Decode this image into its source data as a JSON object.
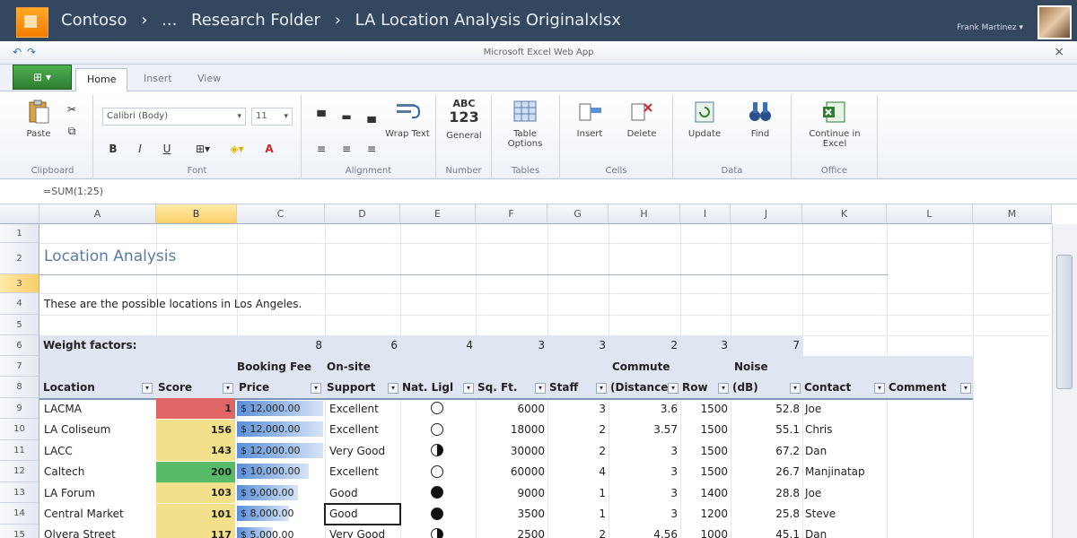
{
  "window": {
    "breadcrumb": [
      "Contoso",
      "›",
      "...",
      "Research Folder",
      "›",
      "LA Location Analysis Originalxlsx"
    ],
    "user": "Frank Martinez ▾",
    "app_title": "Microsoft Excel Web App",
    "close": "×"
  },
  "tabs": {
    "file": "⊞ ▾",
    "items": [
      "Home",
      "Insert",
      "View"
    ]
  },
  "ribbon": {
    "clipboard": {
      "paste": "Paste",
      "label": "Clipboard"
    },
    "font": {
      "name": "Calibri (Body)",
      "size": "11",
      "label": "Font",
      "bold": "B",
      "italic": "I",
      "underline": "U",
      "color_a": "A"
    },
    "alignment": {
      "wrap": "Wrap Text",
      "label": "Alignment"
    },
    "number": {
      "abc": "ABC",
      "num": "123",
      "general": "General",
      "label": "Number"
    },
    "tables": {
      "options": "Table Options",
      "label": "Tables"
    },
    "cells": {
      "insert": "Insert",
      "delete": "Delete",
      "label": "Cells"
    },
    "data": {
      "update": "Update",
      "find": "Find",
      "label": "Data"
    },
    "office": {
      "open": "Continue in Excel",
      "label": "Office"
    }
  },
  "formula": "=SUM(1:25)",
  "columns": [
    "A",
    "B",
    "C",
    "D",
    "E",
    "F",
    "G",
    "H",
    "I",
    "J",
    "K",
    "L",
    "M"
  ],
  "rows": [
    "1",
    "2",
    "3",
    "4",
    "5",
    "6",
    "7",
    "8",
    "9",
    "10",
    "11",
    "12",
    "13",
    "14",
    "15"
  ],
  "sheet": {
    "title": "Location Analysis",
    "subtitle": "These are the possible locations in Los Angeles.",
    "weight_label": "Weight factors:",
    "weights": [
      "8",
      "6",
      "4",
      "3",
      "3",
      "2",
      "3",
      "7"
    ],
    "header_top": {
      "price": "Booking Fee",
      "support": "On-site",
      "commute": "Commute",
      "noise": "Noise"
    },
    "headers": [
      "Location",
      "Score",
      "Price",
      "Support",
      "Nat. Ligl",
      "Sq. Ft.",
      "Staff",
      "(Distance",
      "Row",
      "(dB)",
      "Contact",
      "Comment"
    ],
    "data": [
      {
        "loc": "LACMA",
        "score": "1",
        "price": "$ 12,000.00",
        "support": "Excellent",
        "sqft": "6000",
        "staff": "3",
        "dist": "3.6",
        "row": "1500",
        "db": "52.8",
        "contact": "Joe"
      },
      {
        "loc": "LA Coliseum",
        "score": "156",
        "price": "$ 12,000.00",
        "support": "Excellent",
        "sqft": "18000",
        "staff": "2",
        "dist": "3.57",
        "row": "1500",
        "db": "55.1",
        "contact": "Chris"
      },
      {
        "loc": "LACC",
        "score": "143",
        "price": "$ 12,000.00",
        "support": "Very Good",
        "sqft": "30000",
        "staff": "2",
        "dist": "3",
        "row": "1500",
        "db": "67.2",
        "contact": "Dan"
      },
      {
        "loc": "Caltech",
        "score": "200",
        "price": "$ 10,000.00",
        "support": "Excellent",
        "sqft": "60000",
        "staff": "4",
        "dist": "3",
        "row": "1500",
        "db": "26.7",
        "contact": "Manjinatap"
      },
      {
        "loc": "LA Forum",
        "score": "103",
        "price": "$ 9,000.00",
        "support": "Good",
        "sqft": "9000",
        "staff": "1",
        "dist": "3",
        "row": "1400",
        "db": "28.8",
        "contact": "Joe"
      },
      {
        "loc": "Central Market",
        "score": "101",
        "price": "$ 8,000.00",
        "support": "Good",
        "sqft": "3500",
        "staff": "1",
        "dist": "3",
        "row": "1200",
        "db": "25.8",
        "contact": "Steve"
      },
      {
        "loc": "Olvera Street",
        "score": "117",
        "price": "$ 5,000.00",
        "support": "Very Good",
        "sqft": "2500",
        "staff": "2",
        "dist": "4.56",
        "row": "1000",
        "db": "45.1",
        "contact": "Dan"
      }
    ]
  },
  "colors": {
    "red": "#e06666",
    "yellow": "#f3e08a",
    "green": "#57bb6a"
  }
}
